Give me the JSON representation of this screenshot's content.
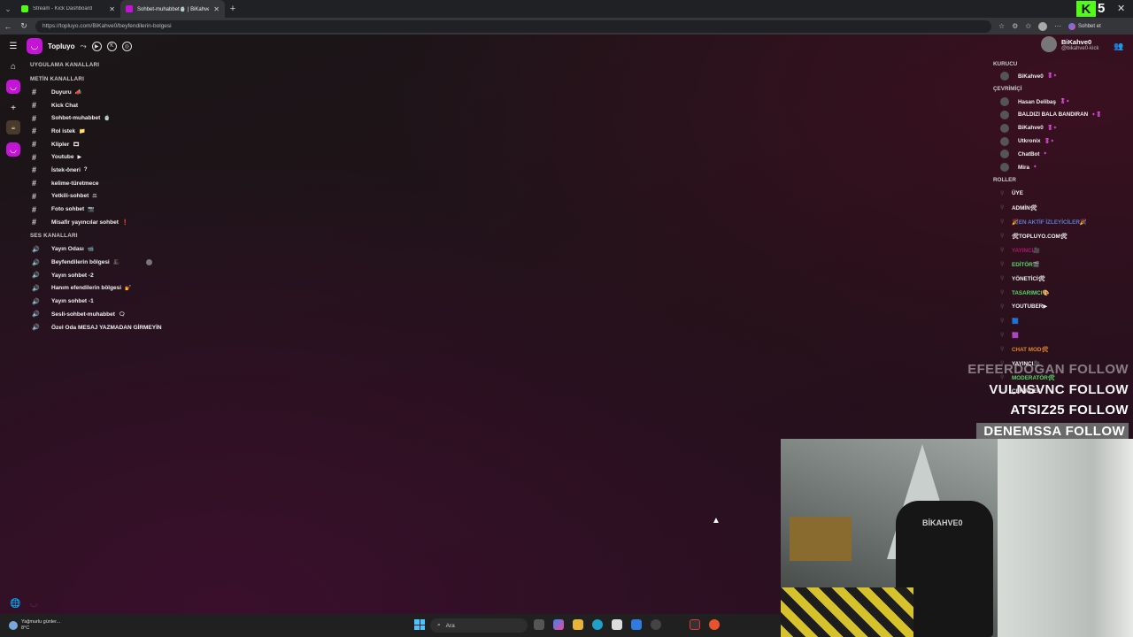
{
  "browser": {
    "tabs": [
      {
        "title": "Stream - Kick Dashboard",
        "color": "#53fc18",
        "active": false
      },
      {
        "title": "Sohbet-muhabbet🍵 | BiKahve0/To...",
        "color": "#c414d6",
        "active": true
      }
    ],
    "url": "https://topluyo.com/BiKahve0/beyfendilerin-bolgesi",
    "kick_count": "5",
    "chat_button": "Sohbet et"
  },
  "server": {
    "name": "Topluyo"
  },
  "channels": {
    "app_section": "UYGULAMA KANALLARI",
    "text_section": "METİN KANALLARI",
    "text": [
      {
        "name": "Duyuru",
        "tag": "📣"
      },
      {
        "name": "Kick Chat",
        "tag": ""
      },
      {
        "name": "Sohbet-muhabbet",
        "tag": "🍵"
      },
      {
        "name": "Rol istek",
        "tag": "📁"
      },
      {
        "name": "Klipler",
        "tag": "🎞"
      },
      {
        "name": "Youtube",
        "tag": "▶"
      },
      {
        "name": "İstek-öneri",
        "tag": "?"
      },
      {
        "name": "kelime-türetmece",
        "tag": ""
      },
      {
        "name": "Yetkili-sohbet",
        "tag": "⚖"
      },
      {
        "name": "Foto sohbet",
        "tag": "📷"
      },
      {
        "name": "Misafir yayıncılar sohbet",
        "tag": "❗"
      }
    ],
    "voice_section": "SES KANALLARI",
    "voice": [
      {
        "name": "Yayın Odası",
        "tag": "📹"
      },
      {
        "name": "Beyfendilerin bölgesi",
        "tag": "🎩"
      },
      {
        "name": "Yayın sohbet -2",
        "tag": ""
      },
      {
        "name": "Hanım efendilerin bölgesi",
        "tag": "💅"
      },
      {
        "name": "Yayın sohbet -1",
        "tag": ""
      },
      {
        "name": "Sesli-sohbet-muhabbet",
        "tag": "🗨"
      },
      {
        "name": "Özel Oda MESAJ YAZMADAN GİRMEYİN",
        "tag": ""
      }
    ]
  },
  "profile": {
    "name": "BiKahve0",
    "handle": "@bikahve0-kick"
  },
  "members": {
    "founder_section": "KURUCU",
    "founders": [
      {
        "name": "BiKahve0",
        "badge": "🎖✦"
      }
    ],
    "online_section": "ÇEVRİMİÇİ",
    "online": [
      {
        "name": "Hasan Delibaş",
        "badge": "🎖✦"
      },
      {
        "name": "BALDIZI BALA BANDIRAN",
        "badge": "✦🎖"
      },
      {
        "name": "BiKahve0",
        "badge": "🎖✦"
      },
      {
        "name": "Utkronix",
        "badge": "🎖✦"
      },
      {
        "name": "ChatBot",
        "badge": "✦"
      },
      {
        "name": "Mira",
        "badge": "✦"
      }
    ],
    "roles_section": "ROLLER",
    "roles": [
      {
        "name": "ÜYE",
        "color": "#f0f0f0"
      },
      {
        "name": "ADMİN🛠",
        "color": "#f0f0f0"
      },
      {
        "name": "🎉EN AKTİF İZLEYİCİLER🎉",
        "color": "#5b7bd6"
      },
      {
        "name": "🛠TOPLUYO.COM🛠",
        "color": "#f0f0f0"
      },
      {
        "name": "YAYINCI🎥",
        "color": "#b0166f"
      },
      {
        "name": "EDİTÖR🎬",
        "color": "#55d86a"
      },
      {
        "name": "YÖNETİCİ🛠",
        "color": "#f0f0f0"
      },
      {
        "name": "TASARIMCI🎨",
        "color": "#55d86a"
      },
      {
        "name": "YOUTUBER▶",
        "color": "#f0f0f0"
      },
      {
        "name": "🟦",
        "color": "#4a8ee0"
      },
      {
        "name": "🟪",
        "color": "#e04ac8"
      },
      {
        "name": "CHAT MOD🛠",
        "color": "#e0862a"
      },
      {
        "name": "YAYINCI🎥",
        "color": "#f0f0f0"
      },
      {
        "name": "MODERATÖR🛠",
        "color": "#55d86a"
      },
      {
        "name": "ÇEKİRDEK",
        "color": "#f0f0f0"
      }
    ]
  },
  "follow_alerts": [
    {
      "user": "EFEERDOGAN",
      "label": "FOLLOW"
    },
    {
      "user": "VULNSVNC",
      "label": "FOLLOW"
    },
    {
      "user": "ATSIZ25",
      "label": "FOLLOW"
    },
    {
      "user": "DENEMSSA",
      "label": "FOLLOW"
    }
  ],
  "webcam": {
    "chair_text": "BİKAHVE0"
  },
  "taskbar": {
    "weather_text": "Yağmurlu günler...",
    "weather_temp": "8°C",
    "search_placeholder": "Ara"
  }
}
